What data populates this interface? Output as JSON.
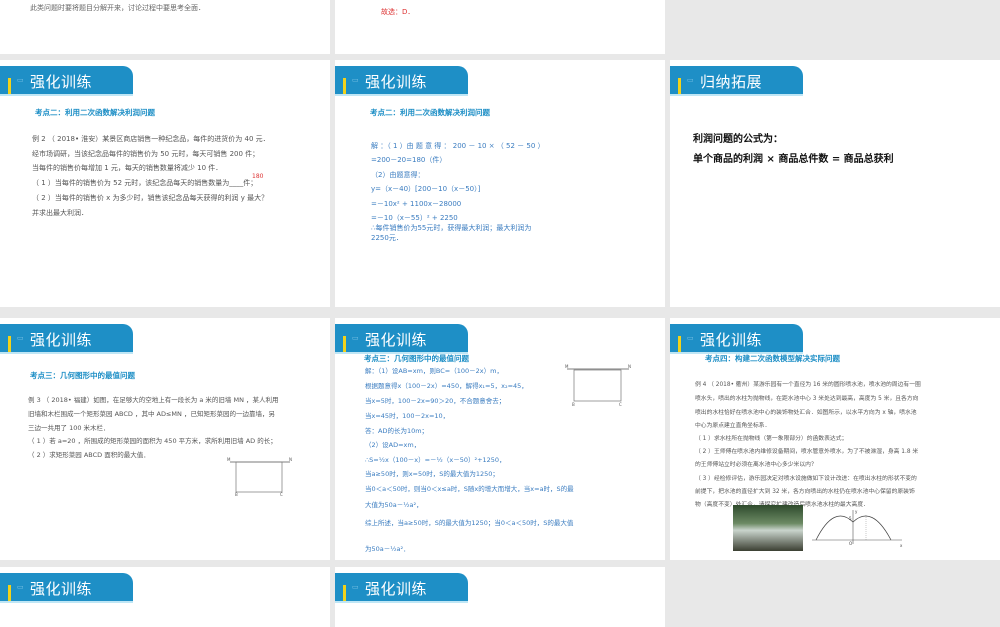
{
  "slides": [
    {
      "id": "prev-1",
      "lines": [
        "此类问题时要将题目分解开来，讨论过程中要思考全面．"
      ]
    },
    {
      "id": "prev-2",
      "lines": [
        "故选：D．"
      ]
    },
    {
      "id": "s1",
      "tab": "强化训练",
      "subtitle": "考点二：利用二次函数解决利润问题",
      "lines": [
        "例 2 （ 2018• 淮安）某景区商店销售一种纪念品，每件的进货价为 40 元．",
        "经市场调研，当该纪念品每件的销售价为 50 元时，每天可销售 200 件；",
        "当每件的销售价每增加 1 元，每天的销售数量将减少 10 件．",
        "（ 1 ）当每件的销售价为 52 元时，该纪念品每天的销售数量为____件；",
        "（ 2 ）当每件的销售价 x 为多少时，销售该纪念品每天获得的利润 y 最大？",
        "并求出最大利润．"
      ],
      "answer": "180"
    },
    {
      "id": "s2",
      "tab": "强化训练",
      "subtitle": "考点二：利用二次函数解决利润问题",
      "lines": [
        "解 ：（ 1 ）由 题 意 得 ： 200 － 10 × （ 52 － 50 ）",
        "=200－20=180（件）",
        "（2）由题意得：",
        "y=（x－40）[200－10（x－50）]",
        "=－10x² + 1100x－28000",
        "=－10（x－55）² + 2250",
        "∴每件销售价为55元时，获得最大利润；最大利润为",
        "2250元．"
      ]
    },
    {
      "id": "s3",
      "tab": "归纳拓展",
      "lines": [
        "利润问题的公式为：",
        "单个商品的利润 × 商品总件数 = 商品总获利"
      ]
    },
    {
      "id": "s4",
      "tab": "强化训练",
      "subtitle": "考点三：几何图形中的最值问题",
      "lines": [
        "例 3 （ 2018• 福建）如图，在足够大的空地上有一段长为 a 米的旧墙 MN ，某人利用",
        "旧墙和木栏围成一个矩形菜园 ABCD ，其中 AD≤MN ，已知矩形菜园的一边靠墙，另",
        "三边一共用了 100 米木栏．",
        "（ 1 ）若 a=20 ，所围成的矩形菜园的面积为 450 平方米，求所利用旧墙 AD 的长；",
        "（ 2 ）求矩形菜园 ABCD 面积的最大值．"
      ],
      "figure_labels": [
        "M",
        "N",
        "A",
        "D",
        "B",
        "C"
      ]
    },
    {
      "id": "s5",
      "tab": "强化训练",
      "subtitle": "考点三：几何图形中的最值问题",
      "lines": [
        "解：（1）设AB=xm，则BC=（100－2x）m，",
        "根据题意得x（100－2x）=450，解得x₁=5，x₂=45，",
        "当x=5时，100－2x=90＞20，不合题意舍去；",
        "当x=45时，100－2x=10，",
        "答：AD的长为10m；",
        "（2）设AD=xm，",
        "∴S=½x（100－x）=－½（x－50）²+1250，",
        "当a≥50时，则x=50时，S的最大值为1250；",
        "当0＜a＜50时，则当0＜x≤a时，S随x的增大而增大，当x=a时，S的最",
        "大值为50a－½a²，",
        "综上所述，当a≥50时，S的最大值为1250；当0＜a＜50时，S的最大值",
        "为50a－½a²．"
      ],
      "figure_labels": [
        "M",
        "N",
        "A",
        "D",
        "B",
        "C"
      ]
    },
    {
      "id": "s6",
      "tab": "强化训练",
      "subtitle": "考点四：构建二次函数模型解决实际问题",
      "lines": [
        "例 4 （ 2018• 衢州）某游乐园有一个直径为 16 米的圆形喷水池，喷水池的周边有一圈",
        "喷水头，喷出的水柱为抛物线，在距水池中心 3 米处达到最高，高度为 5 米，且各方向",
        "喷出的水柱恰好在喷水池中心的装饰物处汇合．如图所示，以水平方向为 x 轴，喷水池",
        "中心为原点建立直角坐标系．",
        "（ 1 ）求水柱所在抛物线（第一象限部分）的函数表达式；",
        "（ 2 ）王师傅在喷水池内维修设备期间，喷水管意外喷水，为了不被淋湿，身高 1.8 米",
        "的王师傅站立时必须在离水池中心多少米以内？",
        "（ 3 ）经检修评估，游乐园决定对喷水设施做如下设计改进：在喷出水柱的形状不变的",
        "前提下，把水池的直径扩大到 32 米，各方向喷出的水柱仍在喷水池中心保留的原装饰",
        "物（高度不变）处汇合，请探究扩建改造后喷水池水柱的最大高度．"
      ],
      "graph_labels": [
        "y",
        "x",
        "O",
        "5"
      ]
    },
    {
      "id": "s7",
      "tab": "强化训练"
    },
    {
      "id": "s8",
      "tab": "强化训练"
    }
  ],
  "colors": {
    "accent": "#1e8fc6",
    "tab_bar": "#f2d21a",
    "background": "#e8e8e8"
  }
}
